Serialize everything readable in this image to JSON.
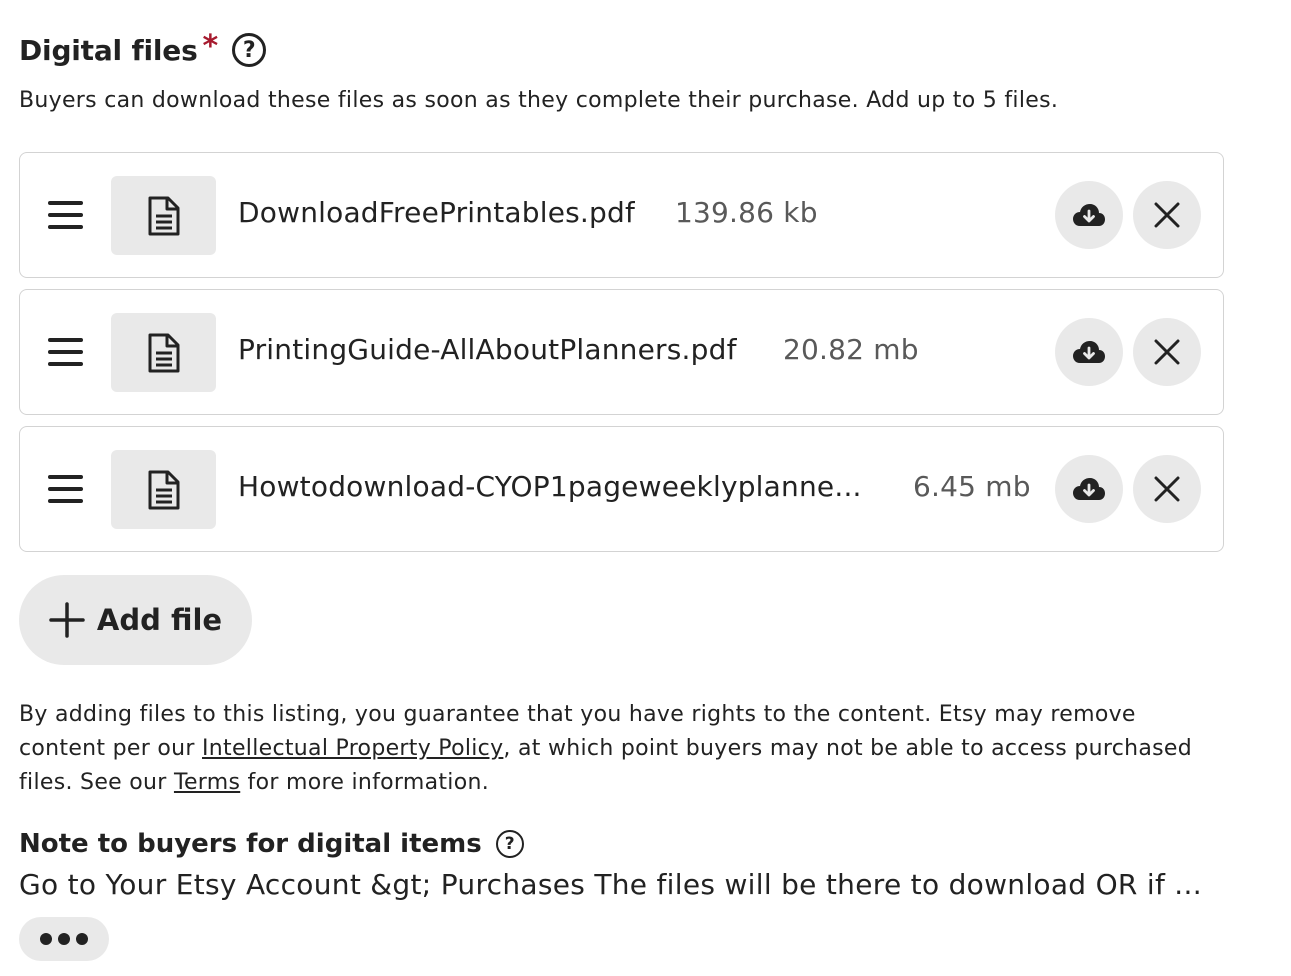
{
  "digital_files": {
    "title": "Digital files",
    "required_mark": "*",
    "help_symbol": "?",
    "description": "Buyers can download these files as soon as they complete their purchase. Add up to 5 files.",
    "files": [
      {
        "name": "DownloadFreePrintables.pdf",
        "size": "139.86 kb"
      },
      {
        "name": "PrintingGuide-AllAboutPlanners.pdf",
        "size": "20.82 mb"
      },
      {
        "name": "Howtodownload-CYOP1pageweeklyplanne...",
        "size": "6.45 mb"
      }
    ],
    "add_file_label": "Add file"
  },
  "legal": {
    "part1": "By adding files to this listing, you guarantee that you have rights to the content. Etsy may remove content per our ",
    "ip_policy_link": "Intellectual Property Policy",
    "part2": ", at which point buyers may not be able to access purchased files. See our ",
    "terms_link": "Terms",
    "part3": " for more information."
  },
  "note_to_buyers": {
    "title": "Note to buyers for digital items",
    "help_symbol": "?",
    "text": "Go to Your Etsy Account &gt; Purchases The files will be there to download OR if ..."
  },
  "icons": {
    "drag": "drag-handle-icon",
    "file": "document-icon",
    "download": "cloud-download-icon",
    "remove": "close-icon",
    "add": "plus-icon",
    "more": "ellipsis-icon"
  },
  "colors": {
    "text": "#222222",
    "muted": "#595959",
    "required": "#a61a2e",
    "button_bg": "#e9e9e9",
    "border": "#d3d3d3"
  }
}
